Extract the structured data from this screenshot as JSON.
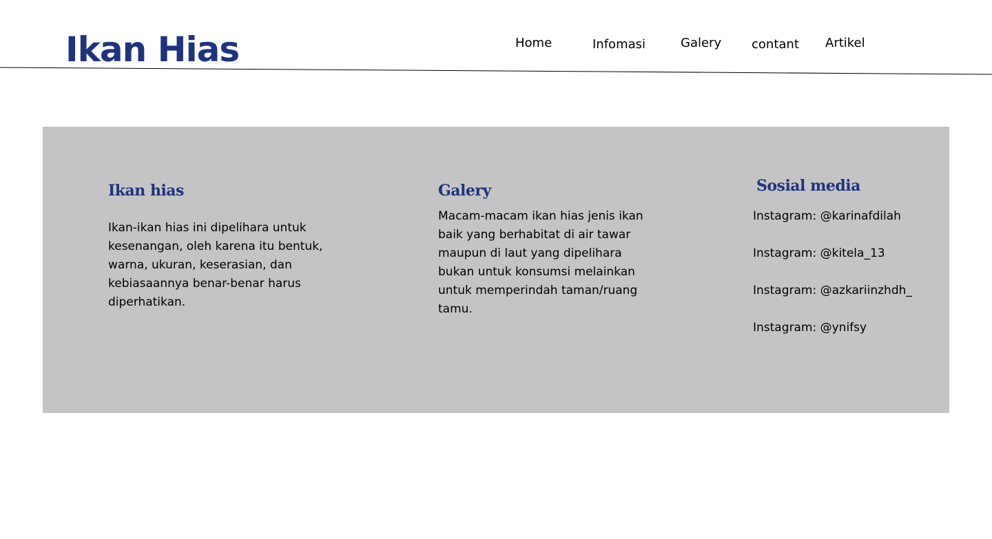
{
  "colors": {
    "brand": "#1f3380",
    "panel": "#c4c4c4",
    "text": "#000000",
    "background": "#ffffff"
  },
  "header": {
    "logo": "Ikan Hias"
  },
  "nav": {
    "items": [
      {
        "label": "Home"
      },
      {
        "label": "Infomasi"
      },
      {
        "label": "Galery"
      },
      {
        "label": "contant"
      },
      {
        "label": "Artikel"
      }
    ]
  },
  "footer": {
    "about": {
      "heading": "Ikan hias",
      "text": "Ikan-ikan hias ini dipelihara untuk kesenangan, oleh karena itu bentuk, warna, ukuran, keserasian, dan kebiasaannya benar-benar harus diperhatikan."
    },
    "gallery": {
      "heading": "Galery",
      "text": "Macam-macam ikan hias jenis ikan baik yang berhabitat di air tawar maupun di laut yang dipelihara bukan untuk konsumsi melainkan untuk memperindah taman/ruang tamu."
    },
    "social": {
      "heading": "Sosial media",
      "items": [
        {
          "label": "Instagram: @karinafdilah"
        },
        {
          "label": "Instagram: @kitela_13"
        },
        {
          "label": "Instagram: @azkariinzhdh_"
        },
        {
          "label": "Instagram: @ynifsy"
        }
      ]
    }
  }
}
